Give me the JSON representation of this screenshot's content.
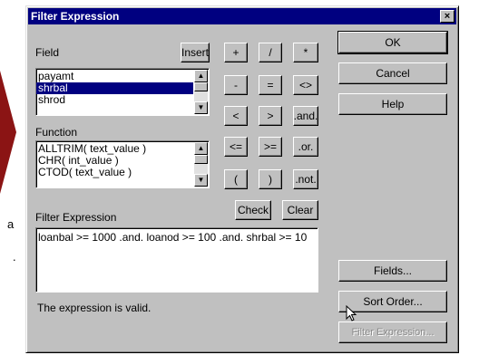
{
  "background": {
    "text_a": "a",
    "text_dot": "."
  },
  "dialog": {
    "title": "Filter Expression",
    "close_glyph": "×",
    "field": {
      "label": "Field",
      "insert_label": "Insert",
      "items": [
        "payamt",
        "shrbal",
        "shrod"
      ],
      "selected_index": 1
    },
    "function": {
      "label": "Function",
      "items": [
        "ALLTRIM( text_value )",
        "CHR( int_value )",
        "CTOD( text_value )"
      ]
    },
    "operators": {
      "plus": "+",
      "slash": "/",
      "star": "*",
      "minus": "-",
      "equals": "=",
      "neq": "<>",
      "lt": "<",
      "gt": ">",
      "and": ".and.",
      "le": "<=",
      "ge": ">=",
      "or": ".or.",
      "lparen": "(",
      "rparen": ")",
      "not": ".not."
    },
    "check_label": "Check",
    "clear_label": "Clear",
    "filter_expression": {
      "label": "Filter Expression",
      "value": "loanbal >= 1000 .and. loanod >= 100 .and. shrbal >= 10"
    },
    "status": "The expression is valid.",
    "buttons": {
      "ok": "OK",
      "cancel": "Cancel",
      "help": "Help",
      "fields": "Fields...",
      "sort_order": "Sort Order...",
      "filter_expression": "Filter Expression..."
    },
    "colors": {
      "title_bar": "#000080",
      "face": "#c0c0c0",
      "selection": "#000080"
    }
  }
}
